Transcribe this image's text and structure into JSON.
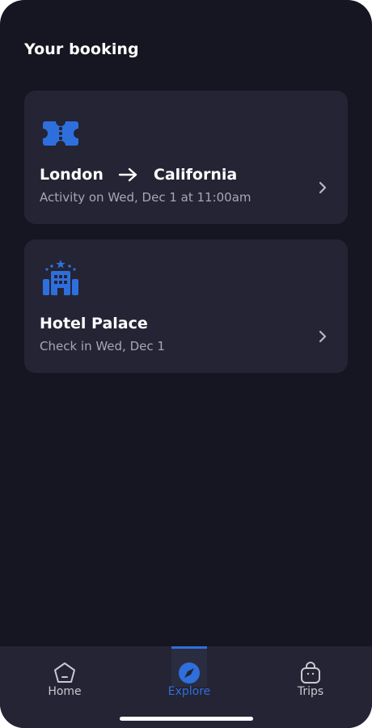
{
  "header": {
    "title": "Your booking"
  },
  "bookings": [
    {
      "icon": "ticket-icon",
      "from": "London",
      "to": "California",
      "subtitle": "Activity on Wed, Dec 1 at 11:00am"
    },
    {
      "icon": "hotel-icon",
      "title": "Hotel Palace",
      "subtitle": "Check in Wed, Dec 1"
    }
  ],
  "tabbar": {
    "tabs": [
      {
        "label": "Home",
        "icon": "home-icon"
      },
      {
        "label": "Explore",
        "icon": "compass-icon",
        "active": true
      },
      {
        "label": "Trips",
        "icon": "bag-icon"
      }
    ]
  },
  "colors": {
    "background": "#161622",
    "card": "#242434",
    "accent": "#2f6fdd",
    "text_primary": "#ffffff",
    "text_secondary": "#a7a7b4"
  }
}
